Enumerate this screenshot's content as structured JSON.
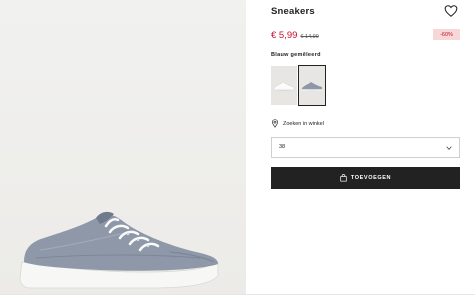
{
  "product": {
    "title": "Sneakers",
    "price_current": "€ 5,99",
    "price_old": "€ 14,99",
    "discount": "-60%",
    "color_label": "Blauw gemêleerd",
    "colors": [
      {
        "name": "white",
        "hex": "#f2f2f2"
      },
      {
        "name": "blue-melange",
        "hex": "#8d97a8"
      }
    ],
    "selected_color_index": 1
  },
  "store": {
    "label": "Zoeken in winkel"
  },
  "size": {
    "value": "38"
  },
  "cart": {
    "add_label": "TOEVOEGEN"
  },
  "icons": {
    "favorite": "heart-icon",
    "store": "location-pin-icon",
    "dropdown": "chevron-down-icon",
    "bag": "shopping-bag-icon"
  },
  "colors": {
    "price_red": "#c3102a",
    "discount_bg": "#f7d8d8",
    "button_bg": "#222222",
    "image_bg": "#efeeeb"
  }
}
